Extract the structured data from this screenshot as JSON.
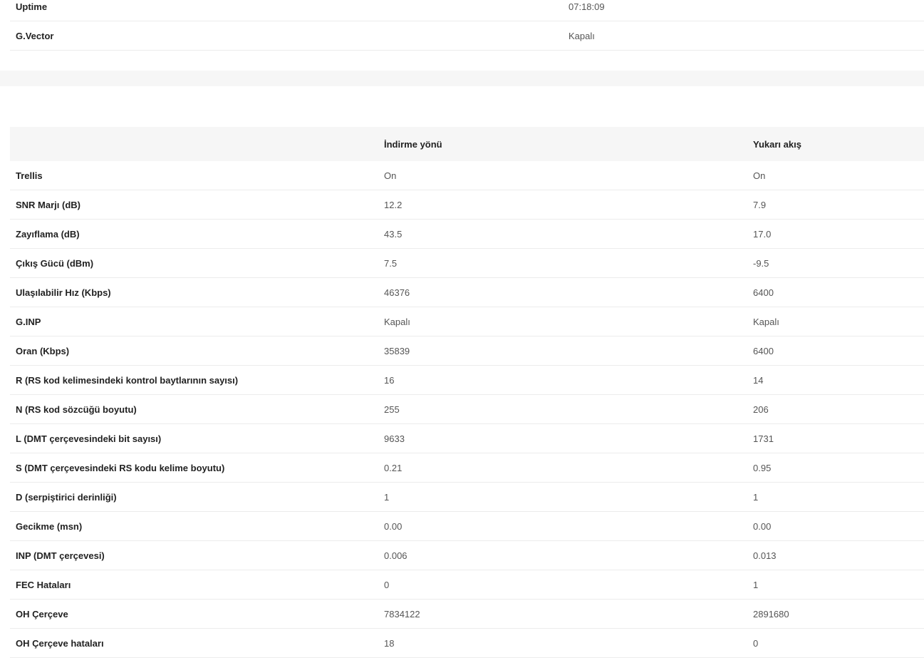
{
  "summary": {
    "rows": [
      {
        "label": "Uptime",
        "value": "07:18:09"
      },
      {
        "label": "G.Vector",
        "value": "Kapalı"
      }
    ]
  },
  "stats": {
    "headers": {
      "label": "",
      "downstream": "İndirme yönü",
      "upstream": "Yukarı akış"
    },
    "rows": [
      {
        "label": "Trellis",
        "down": "On",
        "up": "On"
      },
      {
        "label": "SNR Marjı (dB)",
        "down": "12.2",
        "up": "7.9"
      },
      {
        "label": "Zayıflama (dB)",
        "down": "43.5",
        "up": "17.0"
      },
      {
        "label": "Çıkış Gücü (dBm)",
        "down": "7.5",
        "up": "-9.5"
      },
      {
        "label": "Ulaşılabilir Hız (Kbps)",
        "down": "46376",
        "up": "6400"
      },
      {
        "label": "G.INP",
        "down": "Kapalı",
        "up": "Kapalı"
      },
      {
        "label": "Oran (Kbps)",
        "down": "35839",
        "up": "6400"
      },
      {
        "label": "R (RS kod kelimesindeki kontrol baytlarının sayısı)",
        "down": "16",
        "up": "14"
      },
      {
        "label": "N (RS kod sözcüğü boyutu)",
        "down": "255",
        "up": "206"
      },
      {
        "label": "L (DMT çerçevesindeki bit sayısı)",
        "down": "9633",
        "up": "1731"
      },
      {
        "label": "S (DMT çerçevesindeki RS kodu kelime boyutu)",
        "down": "0.21",
        "up": "0.95"
      },
      {
        "label": "D (serpiştirici derinliği)",
        "down": "1",
        "up": "1"
      },
      {
        "label": "Gecikme (msn)",
        "down": "0.00",
        "up": "0.00"
      },
      {
        "label": "INP (DMT çerçevesi)",
        "down": "0.006",
        "up": "0.013"
      },
      {
        "label": "FEC Hataları",
        "down": "0",
        "up": "1"
      },
      {
        "label": "OH Çerçeve",
        "down": "7834122",
        "up": "2891680"
      },
      {
        "label": "OH Çerçeve hataları",
        "down": "18",
        "up": "0"
      }
    ]
  }
}
